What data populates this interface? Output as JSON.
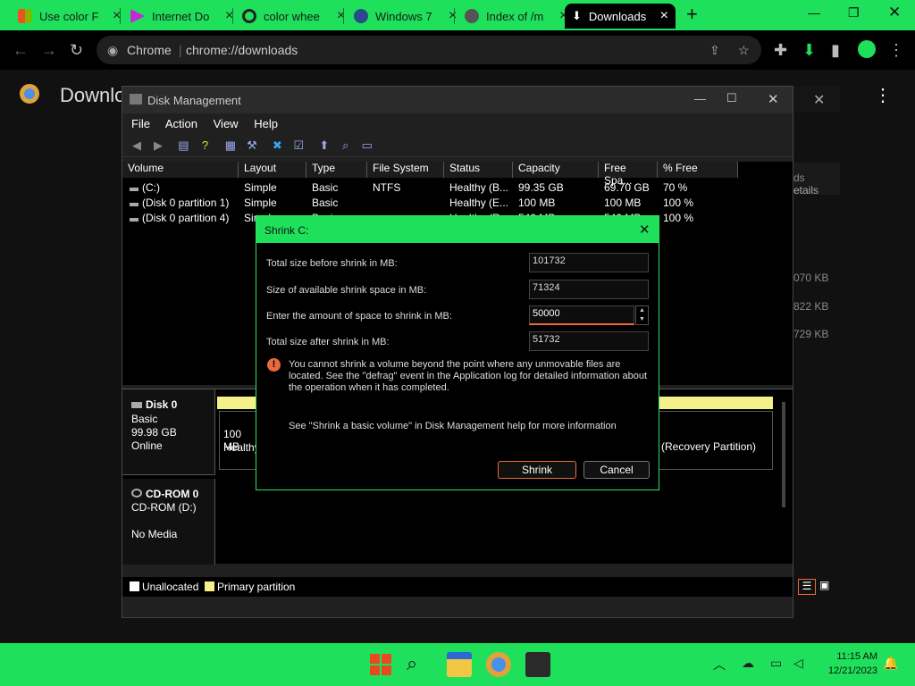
{
  "browser": {
    "tabs": [
      {
        "title": "Use color F",
        "favicon": "#3b6bd9"
      },
      {
        "title": "Internet Do",
        "favicon": "#c02bd6"
      },
      {
        "title": "color whee",
        "favicon": "#ea4335"
      },
      {
        "title": "Windows 7",
        "favicon": "#2a4a8a"
      },
      {
        "title": "Index of /m",
        "favicon": "#777"
      },
      {
        "title": "Downloads",
        "favicon": "#fff"
      }
    ],
    "new_tab": "+",
    "omnibox_chip": "Chrome",
    "url": "chrome://downloads"
  },
  "downloads_page": {
    "title": "Downlo",
    "ghost_labels": [
      "ds",
      "etails",
      "070 KB",
      "822 KB",
      "729 KB"
    ]
  },
  "disk_management": {
    "title": "Disk Management",
    "menu": [
      "File",
      "Action",
      "View",
      "Help"
    ],
    "columns": [
      "Volume",
      "Layout",
      "Type",
      "File System",
      "Status",
      "Capacity",
      "Free Spa...",
      "% Free"
    ],
    "rows": [
      [
        "(C:)",
        "Simple",
        "Basic",
        "NTFS",
        "Healthy (B...",
        "99.35 GB",
        "69.70 GB",
        "70 %"
      ],
      [
        "(Disk 0 partition 1)",
        "Simple",
        "Basic",
        "",
        "Healthy (E...",
        "100 MB",
        "100 MB",
        "100 %"
      ],
      [
        "(Disk 0 partition 4)",
        "Simple",
        "Basic",
        "",
        "Healthy (R...",
        "540 MB",
        "540 MB",
        "100 %"
      ]
    ],
    "disk0": {
      "name": "Disk 0",
      "type": "Basic",
      "size": "99.98 GB",
      "state": "Online",
      "part_left_size": "100 MB",
      "part_left_status": "Healthy",
      "part_right": "(Recovery Partition)"
    },
    "cdrom": {
      "name": "CD-ROM 0",
      "type": "CD-ROM (D:)",
      "state": "No Media"
    },
    "legend": {
      "unallocated": "Unallocated",
      "primary": "Primary partition"
    }
  },
  "shrink_dialog": {
    "title": "Shrink C:",
    "total_before_label": "Total size before shrink in MB:",
    "total_before": "101732",
    "available_label": "Size of available shrink space in MB:",
    "available": "71324",
    "amount_label": "Enter the amount of space to shrink in MB:",
    "amount": "50000",
    "after_label": "Total size after shrink in MB:",
    "after": "51732",
    "warning": "You cannot shrink a volume beyond the point where any unmovable files are located. See the \"defrag\" event in the Application log for detailed information about the operation when it has completed.",
    "help": "See \"Shrink a basic volume\" in Disk Management help for more information",
    "shrink_label": "Shrink",
    "cancel_label": "Cancel"
  },
  "taskbar": {
    "time": "11:15 AM",
    "date": "12/21/2023"
  },
  "colors": {
    "accent": "#1fe05a",
    "primary_partition": "#f4f08a"
  }
}
